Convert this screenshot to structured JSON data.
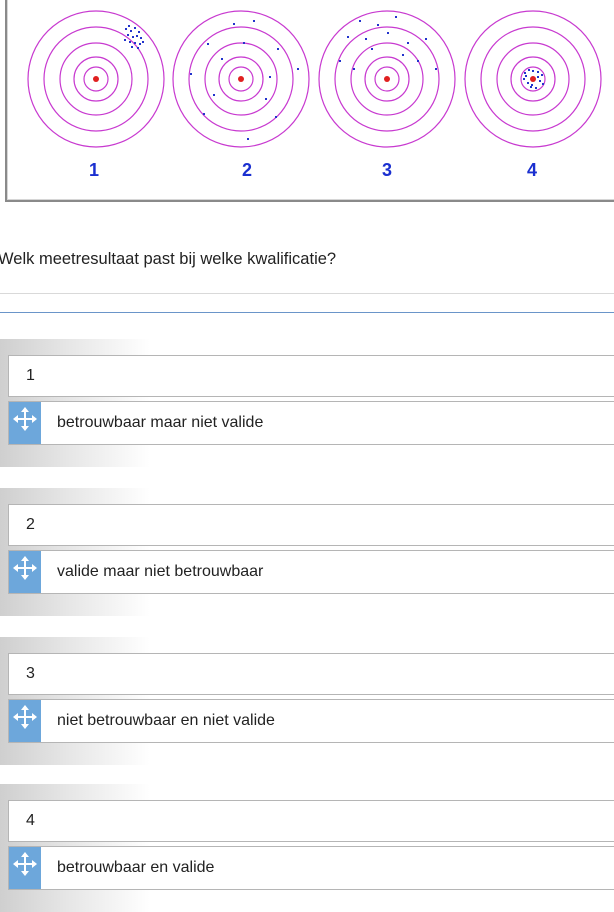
{
  "figure": {
    "labels": [
      "1",
      "2",
      "3",
      "4"
    ],
    "ring_color": "#c83ad0",
    "dot_color": "#2233cc",
    "center_color": "#e02020",
    "label_color": "#1a2fd0"
  },
  "question": "Welk meetresultaat past bij welke kwalificatie?",
  "pairs": [
    {
      "slot": "1",
      "answer": "betrouwbaar maar niet valide"
    },
    {
      "slot": "2",
      "answer": "valide maar niet betrouwbaar"
    },
    {
      "slot": "3",
      "answer": "niet betrouwbaar en niet valide"
    },
    {
      "slot": "4",
      "answer": "betrouwbaar en valide"
    }
  ]
}
